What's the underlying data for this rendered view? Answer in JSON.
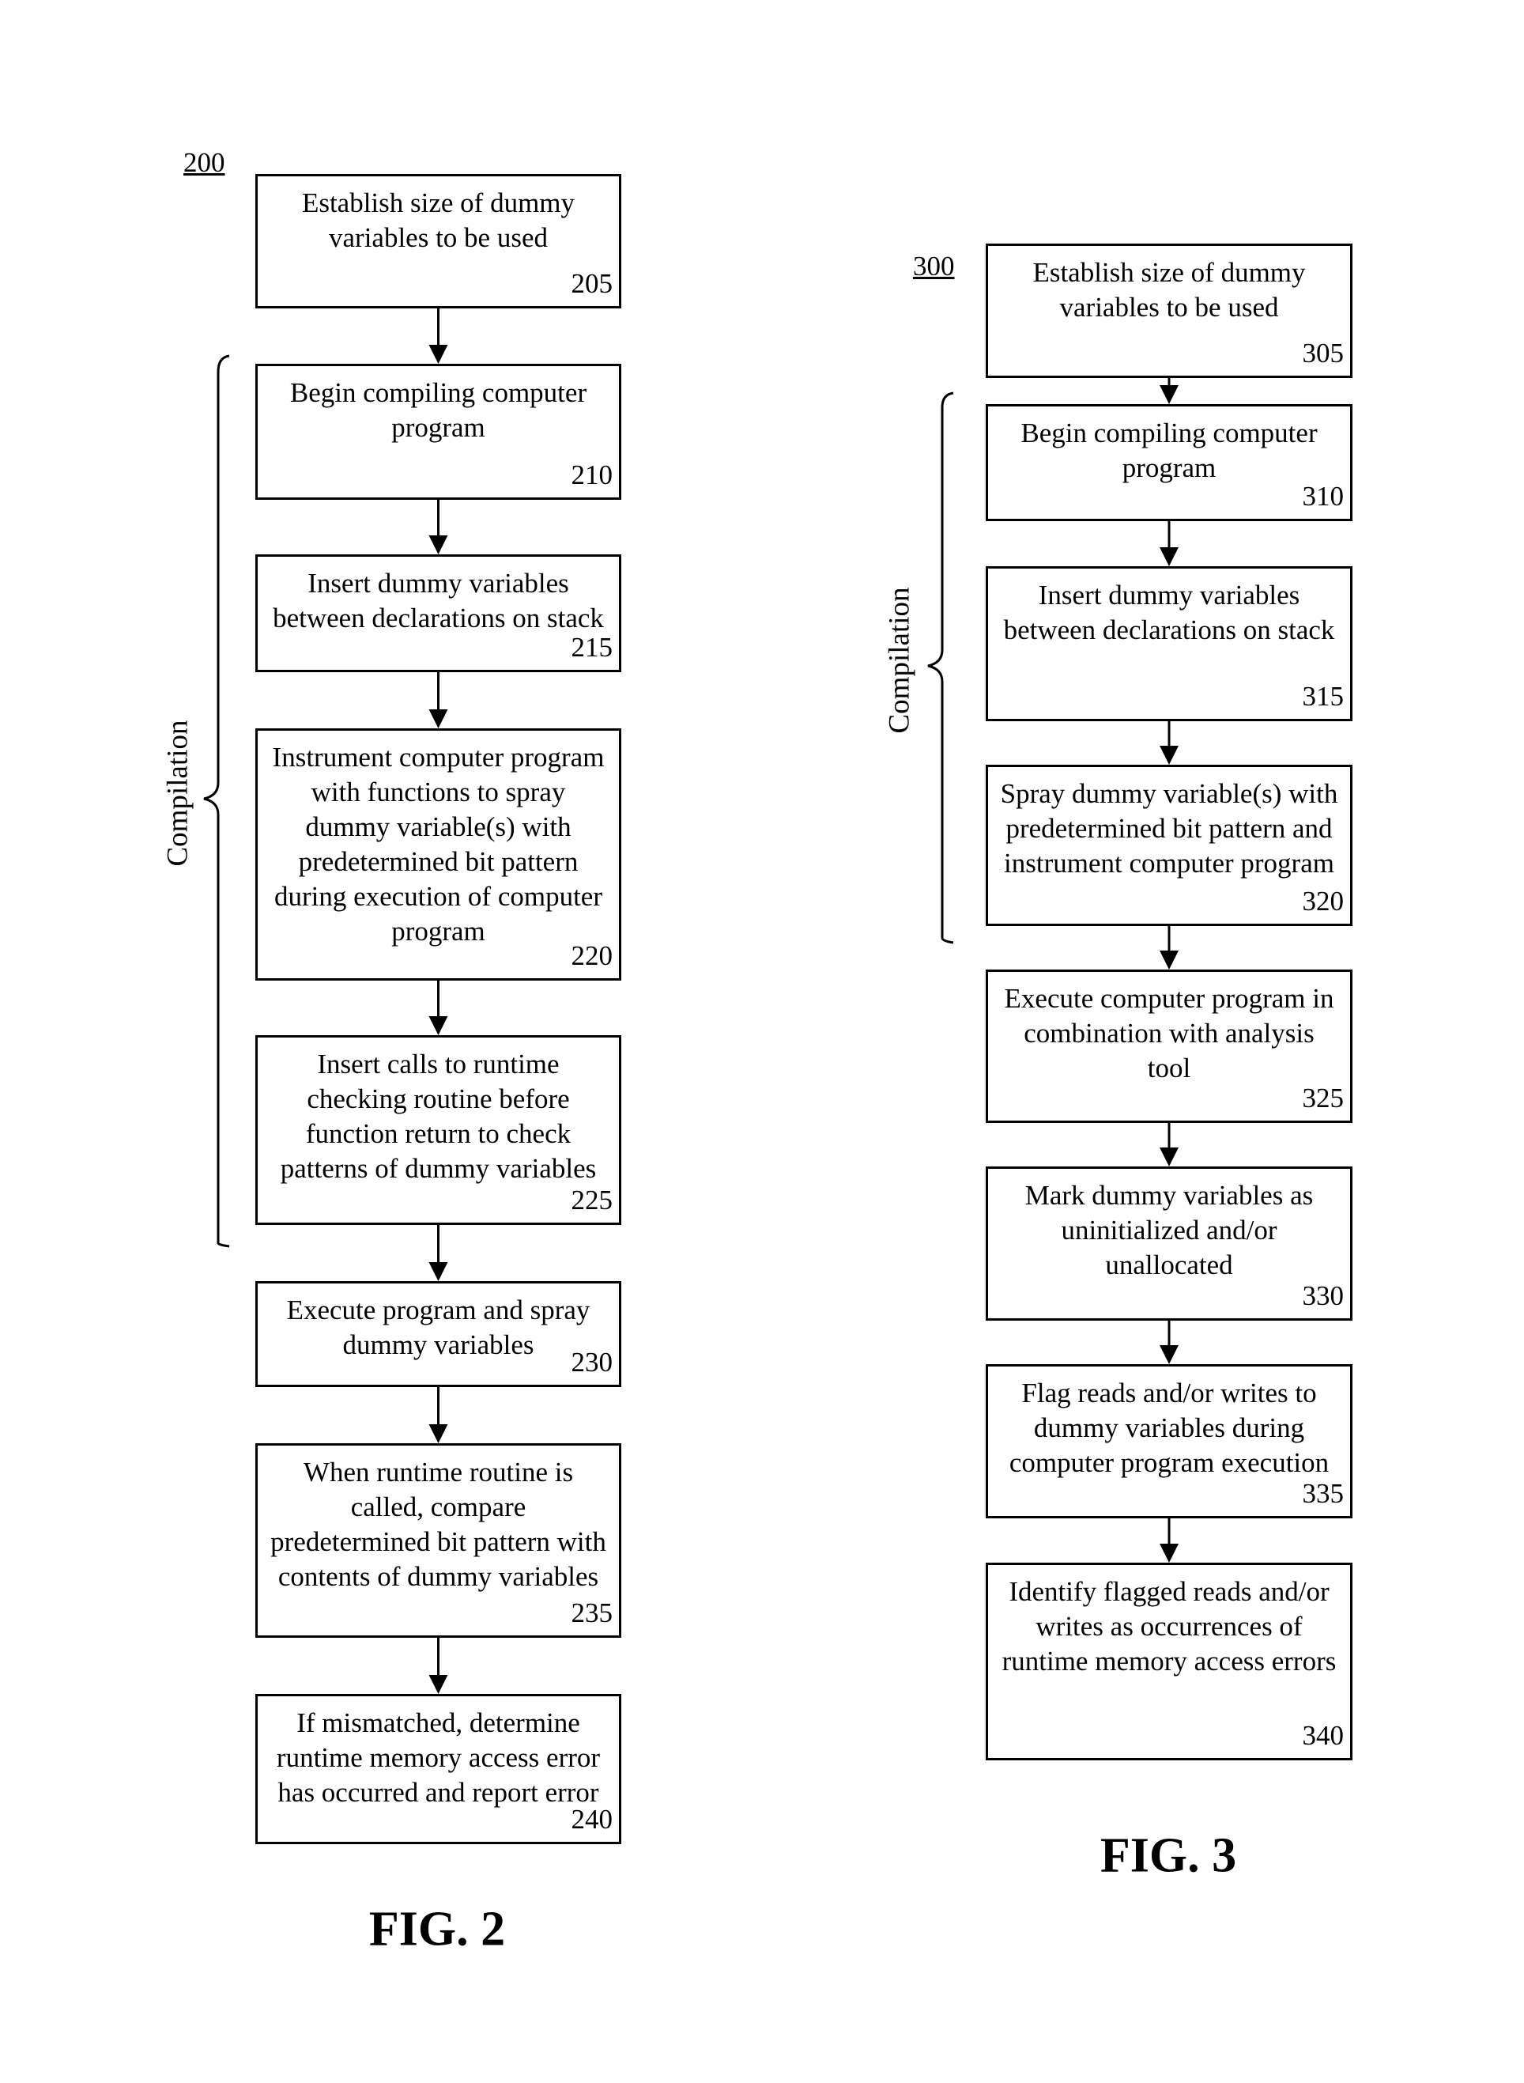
{
  "fig2": {
    "ref": "200",
    "caption": "FIG. 2",
    "bracket_label": "Compilation",
    "steps": [
      {
        "id": "205",
        "text": "Establish size of dummy\nvariables to be used"
      },
      {
        "id": "210",
        "text": "Begin compiling computer\nprogram"
      },
      {
        "id": "215",
        "text": "Insert dummy variables\nbetween declarations on stack"
      },
      {
        "id": "220",
        "text": "Instrument computer program\nwith functions to spray\ndummy variable(s) with\npredetermined bit pattern\nduring execution of computer\nprogram"
      },
      {
        "id": "225",
        "text": "Insert calls to runtime\nchecking routine before\nfunction return to check\npatterns of dummy variables"
      },
      {
        "id": "230",
        "text": "Execute program and spray\ndummy variables"
      },
      {
        "id": "235",
        "text": "When runtime routine is\ncalled, compare\npredetermined bit pattern with\ncontents of dummy variables"
      },
      {
        "id": "240",
        "text": "If mismatched, determine\nruntime memory access error\nhas occurred and report error"
      }
    ]
  },
  "fig3": {
    "ref": "300",
    "caption": "FIG. 3",
    "bracket_label": "Compilation",
    "steps": [
      {
        "id": "305",
        "text": "Establish size of dummy\nvariables to be used"
      },
      {
        "id": "310",
        "text": "Begin compiling computer\nprogram"
      },
      {
        "id": "315",
        "text": "Insert dummy variables\nbetween declarations on stack"
      },
      {
        "id": "320",
        "text": "Spray dummy variable(s) with\npredetermined bit pattern and\ninstrument computer program"
      },
      {
        "id": "325",
        "text": "Execute computer program in\ncombination with analysis\ntool"
      },
      {
        "id": "330",
        "text": "Mark dummy variables as\nuninitialized and/or\nunallocated"
      },
      {
        "id": "335",
        "text": "Flag reads and/or writes to\ndummy variables during\ncomputer program execution"
      },
      {
        "id": "340",
        "text": "Identify flagged reads and/or\nwrites as occurrences of\nruntime memory access errors"
      }
    ]
  }
}
